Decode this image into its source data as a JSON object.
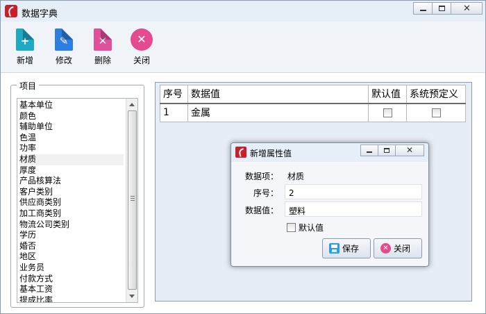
{
  "window": {
    "title": "数据字典",
    "controls": {
      "minimize": "minimize",
      "maximize": "maximize",
      "close": "✕"
    }
  },
  "toolbar": {
    "buttons": [
      {
        "label": "新增",
        "icon": "add-document-icon",
        "color": "#1ea9c4",
        "glyph": "+"
      },
      {
        "label": "修改",
        "icon": "edit-document-icon",
        "color": "#2c7ee0",
        "glyph": "✎"
      },
      {
        "label": "删除",
        "icon": "delete-document-icon",
        "color": "#e0509c",
        "glyph": "✕"
      },
      {
        "label": "关闭",
        "icon": "close-circle-icon",
        "color": "#e24b8e",
        "glyph": "✕"
      }
    ]
  },
  "items_group": {
    "legend": "项目",
    "items": [
      "基本单位",
      "颜色",
      "辅助单位",
      "色温",
      "功率",
      "材质",
      "厚度",
      "产品核算法",
      "客户类别",
      "供应商类别",
      "加工商类别",
      "物流公司类别",
      "学历",
      "婚否",
      "地区",
      "业务员",
      "付款方式",
      "基本工资",
      "提成比率"
    ],
    "selected_index": 5
  },
  "grid": {
    "columns": [
      "序号",
      "数据值",
      "默认值",
      "系统预定义"
    ],
    "rows": [
      {
        "seq": "1",
        "value": "金属",
        "default": false,
        "system": false
      }
    ]
  },
  "dialog": {
    "title": "新增属性值",
    "item_label": "数据项：",
    "item_value": "材质",
    "seq_label": "序号：",
    "seq_value": "2",
    "value_label": "数据值：",
    "value_value": "塑料",
    "default_label": "默认值",
    "default_checked": false,
    "save_label": "保存",
    "close_label": "关闭"
  },
  "colors": {
    "brand_red": "#c8202a",
    "accent_pink": "#e24b8e",
    "save_blue": "#2d9fe0"
  }
}
